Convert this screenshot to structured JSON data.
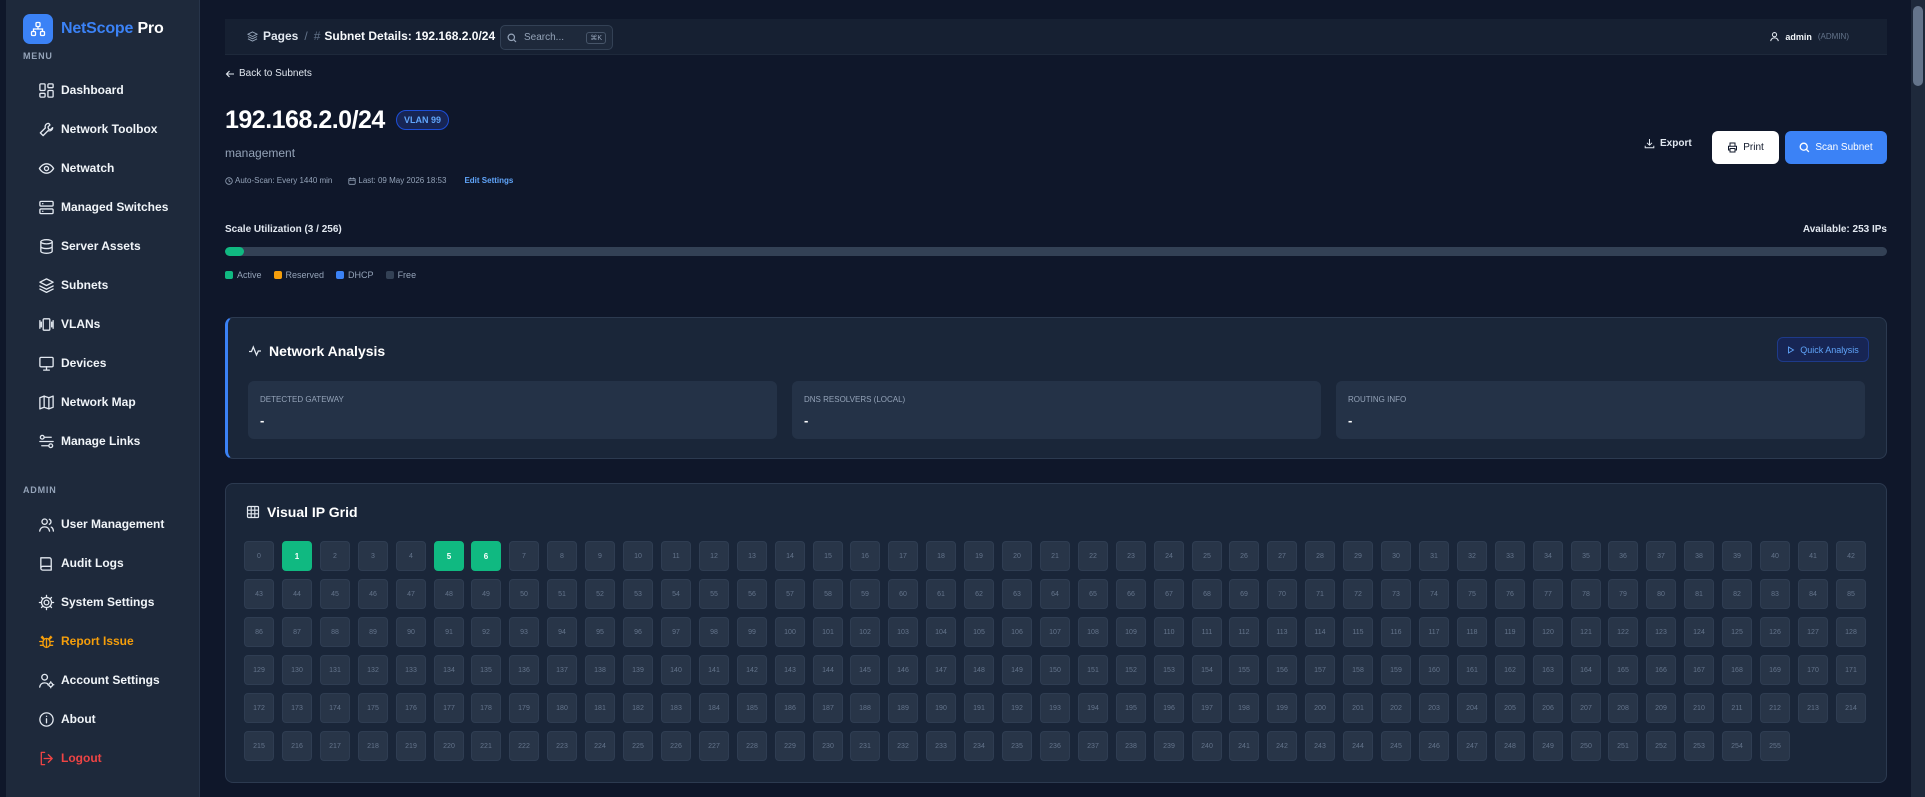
{
  "brand": {
    "name_a": "NetScope",
    "name_b": "Pro"
  },
  "sidebar": {
    "menu_label": "MENU",
    "admin_label": "ADMIN",
    "items": [
      {
        "label": "Dashboard",
        "icon": "dashboard-icon"
      },
      {
        "label": "Network Toolbox",
        "icon": "wrench-icon"
      },
      {
        "label": "Netwatch",
        "icon": "eye-icon"
      },
      {
        "label": "Managed Switches",
        "icon": "server-icon"
      },
      {
        "label": "Server Assets",
        "icon": "database-icon"
      },
      {
        "label": "Subnets",
        "icon": "layers-icon"
      },
      {
        "label": "VLANs",
        "icon": "vlan-icon"
      },
      {
        "label": "Devices",
        "icon": "monitor-icon"
      },
      {
        "label": "Network Map",
        "icon": "map-icon"
      },
      {
        "label": "Manage Links",
        "icon": "links-icon"
      }
    ],
    "admin_items": [
      {
        "label": "User Management",
        "icon": "users-icon"
      },
      {
        "label": "Audit Logs",
        "icon": "book-icon"
      },
      {
        "label": "System Settings",
        "icon": "gear-icon"
      },
      {
        "label": "Report Issue",
        "icon": "bug-icon"
      },
      {
        "label": "Account Settings",
        "icon": "user-cog-icon"
      },
      {
        "label": "About",
        "icon": "info-icon"
      },
      {
        "label": "Logout",
        "icon": "logout-icon"
      }
    ]
  },
  "topbar": {
    "crumb_root": "Pages",
    "crumb_current": "Subnet Details: 192.168.2.0/24",
    "search_placeholder": "Search...",
    "search_shortcut": "⌘K",
    "user_name": "admin",
    "user_role": "(ADMIN)"
  },
  "header": {
    "back_label": "Back to Subnets",
    "title": "192.168.2.0/24",
    "vlan_badge": "VLAN 99",
    "description": "management",
    "auto_scan": "Auto-Scan: Every 1440 min",
    "last_scan": "Last: 09 May 2026 18:53",
    "edit_settings": "Edit Settings",
    "export_label": "Export",
    "print_label": "Print",
    "scan_label": "Scan Subnet"
  },
  "utilization": {
    "label": "Scale Utilization (3 / 256)",
    "available": "Available: 253 IPs",
    "fraction": 0.0117,
    "legend": [
      {
        "label": "Active",
        "color": "#10b981"
      },
      {
        "label": "Reserved",
        "color": "#f59e0b"
      },
      {
        "label": "DHCP",
        "color": "#3b82f6"
      },
      {
        "label": "Free",
        "color": "#334155"
      }
    ]
  },
  "analysis": {
    "title": "Network Analysis",
    "quick_label": "Quick Analysis",
    "cards": [
      {
        "label": "DETECTED GATEWAY",
        "value": "-"
      },
      {
        "label": "DNS RESOLVERS (LOCAL)",
        "value": "-"
      },
      {
        "label": "ROUTING INFO",
        "value": "-"
      }
    ]
  },
  "ip_grid": {
    "title": "Visual IP Grid",
    "total": 256,
    "active": [
      1,
      5,
      6
    ]
  }
}
